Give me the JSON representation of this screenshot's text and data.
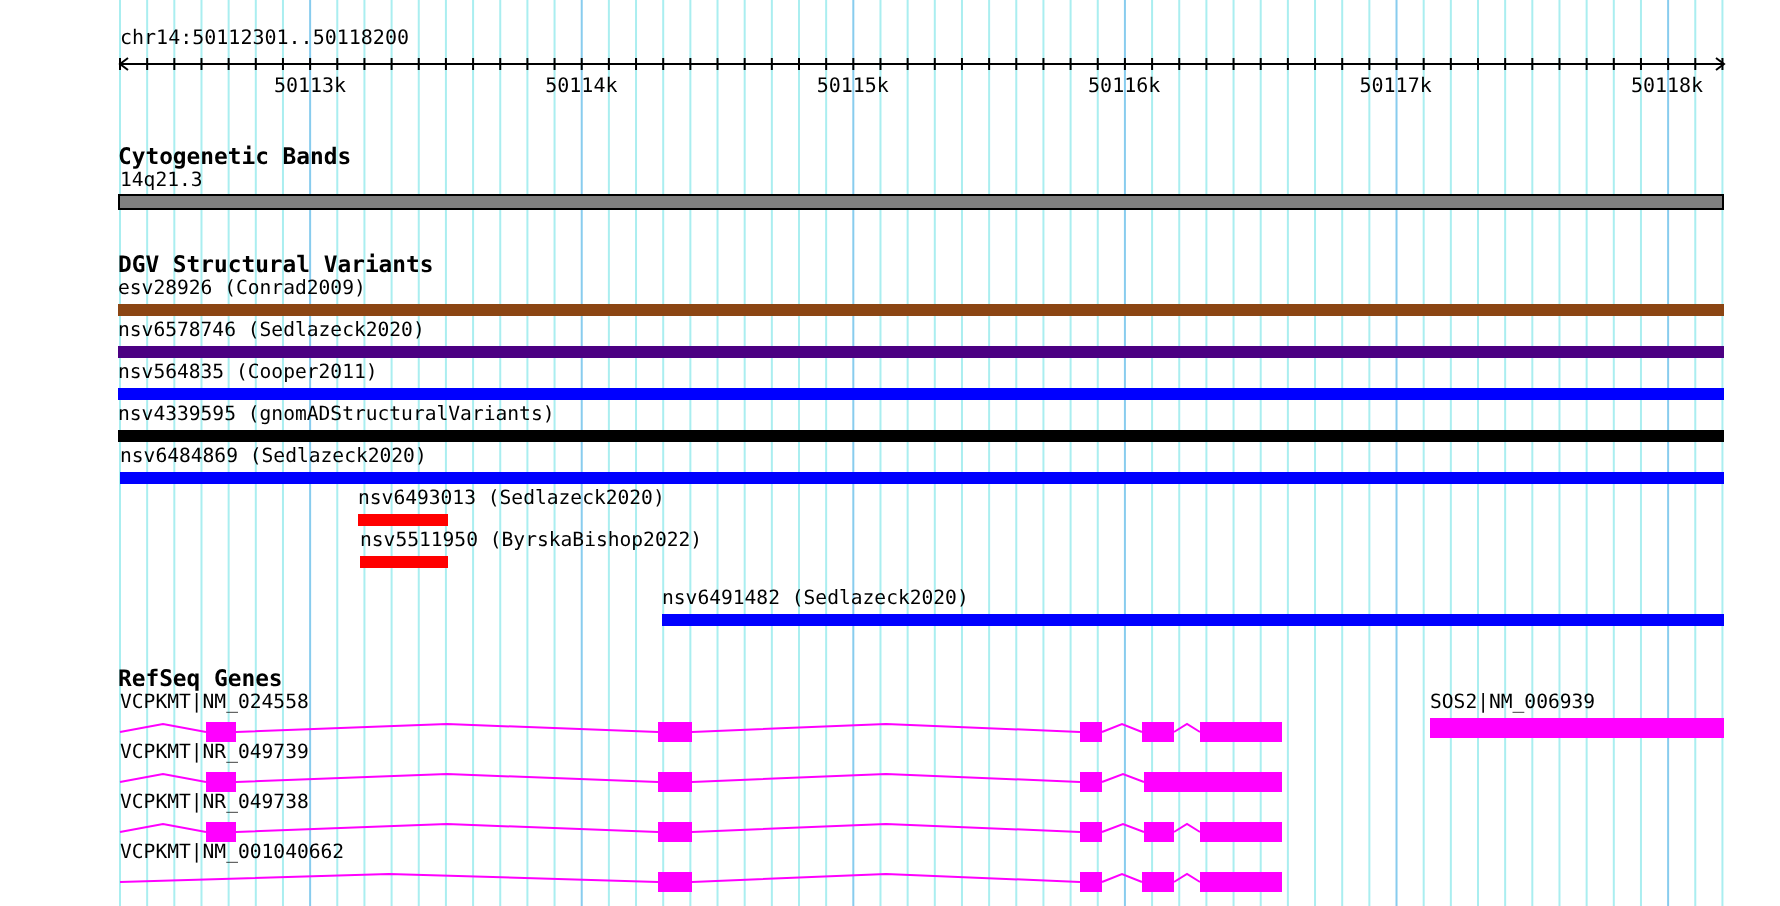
{
  "ruler": {
    "title": "chr14:50112301..50118200",
    "ticks": [
      "50113k",
      "50114k",
      "50115k",
      "50116k",
      "50117k",
      "50118k"
    ]
  },
  "cytogenetic_bands": {
    "title": "Cytogenetic Bands",
    "bands": [
      {
        "label": "14q21.3"
      }
    ]
  },
  "dgv_structural_variants": {
    "title": "DGV Structural Variants",
    "variants": [
      {
        "label": "esv28926 (Conrad2009)",
        "color": "#8b4513"
      },
      {
        "label": "nsv6578746 (Sedlazeck2020)",
        "color": "#4b0082"
      },
      {
        "label": "nsv564835 (Cooper2011)",
        "color": "#0000ff"
      },
      {
        "label": "nsv4339595 (gnomADStructuralVariants)",
        "color": "#000000"
      },
      {
        "label": "nsv6484869 (Sedlazeck2020)",
        "color": "#0000ff"
      },
      {
        "label": "nsv6493013 (Sedlazeck2020)",
        "color": "#ff0000"
      },
      {
        "label": "nsv5511950 (ByrskaBishop2022)",
        "color": "#ff0000"
      },
      {
        "label": "nsv6491482 (Sedlazeck2020)",
        "color": "#0000ff"
      }
    ]
  },
  "refseq_genes": {
    "title": "RefSeq Genes",
    "transcripts": [
      {
        "label": "VCPKMT|NM_024558"
      },
      {
        "label": "VCPKMT|NR_049739"
      },
      {
        "label": "VCPKMT|NR_049738"
      },
      {
        "label": "VCPKMT|NM_001040662"
      }
    ],
    "genes": [
      {
        "label": "SOS2|NM_006939"
      }
    ]
  }
}
